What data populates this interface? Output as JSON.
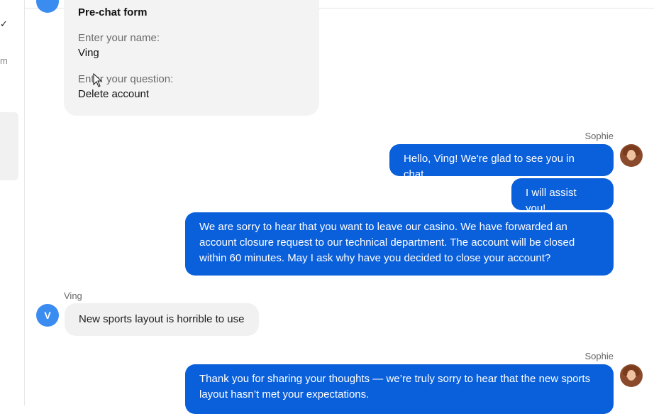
{
  "rail": {
    "check_icon": "check-icon",
    "m_text": "m"
  },
  "prechat": {
    "title": "Pre-chat form",
    "name_label": "Enter your name:",
    "name_value": "Ving",
    "question_label": "Enter your question:",
    "question_value": "Delete account"
  },
  "messages": [
    {
      "sender": "Sophie",
      "text": "Hello, Ving! We're glad to see you in chat."
    },
    {
      "sender": "",
      "text": "I will assist you!"
    },
    {
      "sender": "",
      "text": "We are sorry to hear that you want to leave our casino. We have forwarded an account closure request to our technical department. The account will be closed within 60 minutes. May I ask why have you decided to close your account?"
    },
    {
      "sender": "Ving",
      "avatar_letter": "V",
      "text": "New sports layout is horrible to use"
    },
    {
      "sender": "Sophie",
      "text": "Thank you for sharing your thoughts — we’re truly sorry to hear that the new sports layout hasn’t met your expectations."
    }
  ],
  "colors": {
    "agent_bubble": "#0a5fdb",
    "user_avatar": "#3b8cf0",
    "user_bubble": "#f1f1f1"
  }
}
